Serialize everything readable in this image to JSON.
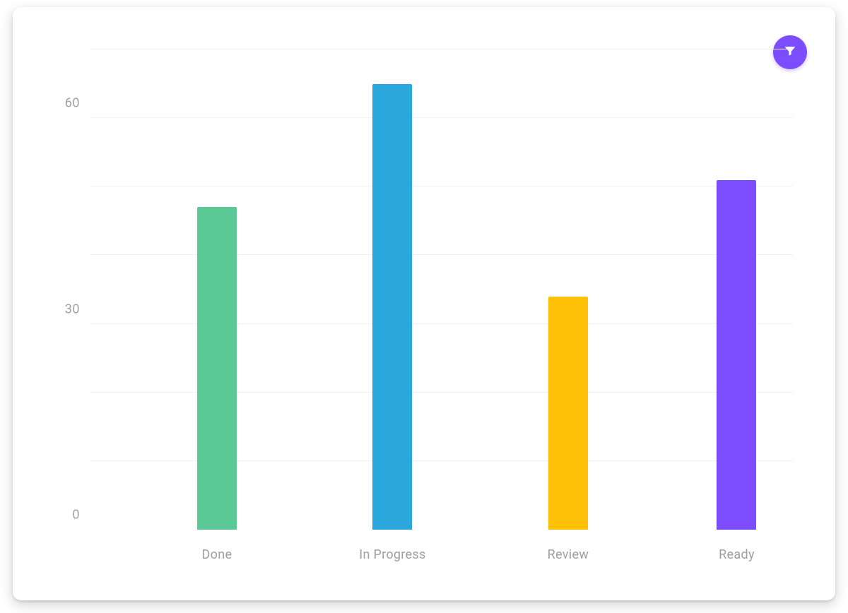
{
  "filter_button": {
    "icon": "filter-icon"
  },
  "chart_data": {
    "type": "bar",
    "categories": [
      "Done",
      "In Progress",
      "Review",
      "Ready"
    ],
    "values": [
      47,
      65,
      34,
      51
    ],
    "colors": [
      "#5bc995",
      "#2aa7dd",
      "#ffc107",
      "#7c4dff"
    ],
    "title": "",
    "xlabel": "",
    "ylabel": "",
    "ylim": [
      0,
      70
    ],
    "yticks": [
      0,
      30,
      60
    ],
    "ytick_labels": [
      "0",
      "30",
      "60"
    ],
    "grid_values": [
      10,
      20,
      30,
      40,
      50,
      60,
      70
    ]
  }
}
